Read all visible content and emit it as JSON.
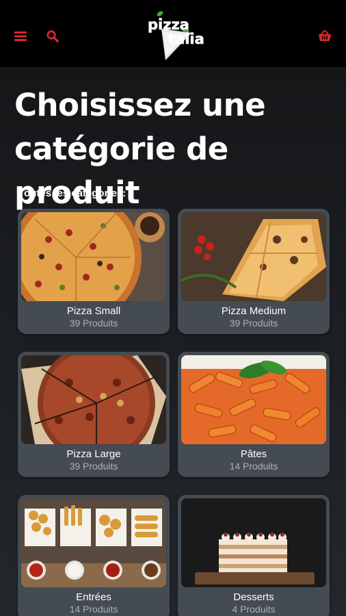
{
  "header": {
    "menu_icon": "menu-icon",
    "search_icon": "search-icon",
    "cart_icon": "basket-icon",
    "logo_line1": "pizza",
    "logo_line2": "talia",
    "accent_color": "#d7282f"
  },
  "main": {
    "title_line1": "Choisissez une",
    "title_line2": "catégorie de produit",
    "section_label": "Toutes les catégories:"
  },
  "categories": [
    {
      "name": "Pizza Small",
      "count": "39 Produits",
      "image": "pizza-whole"
    },
    {
      "name": "Pizza Medium",
      "count": "39 Produits",
      "image": "pizza-slices"
    },
    {
      "name": "Pizza Large",
      "count": "39 Produits",
      "image": "pizza-sliced"
    },
    {
      "name": "Pâtes",
      "count": "14 Produits",
      "image": "penne-pasta"
    },
    {
      "name": "Entrées",
      "count": "14 Produits",
      "image": "fried-starters"
    },
    {
      "name": "Desserts",
      "count": "4 Produits",
      "image": "layered-cake"
    }
  ]
}
